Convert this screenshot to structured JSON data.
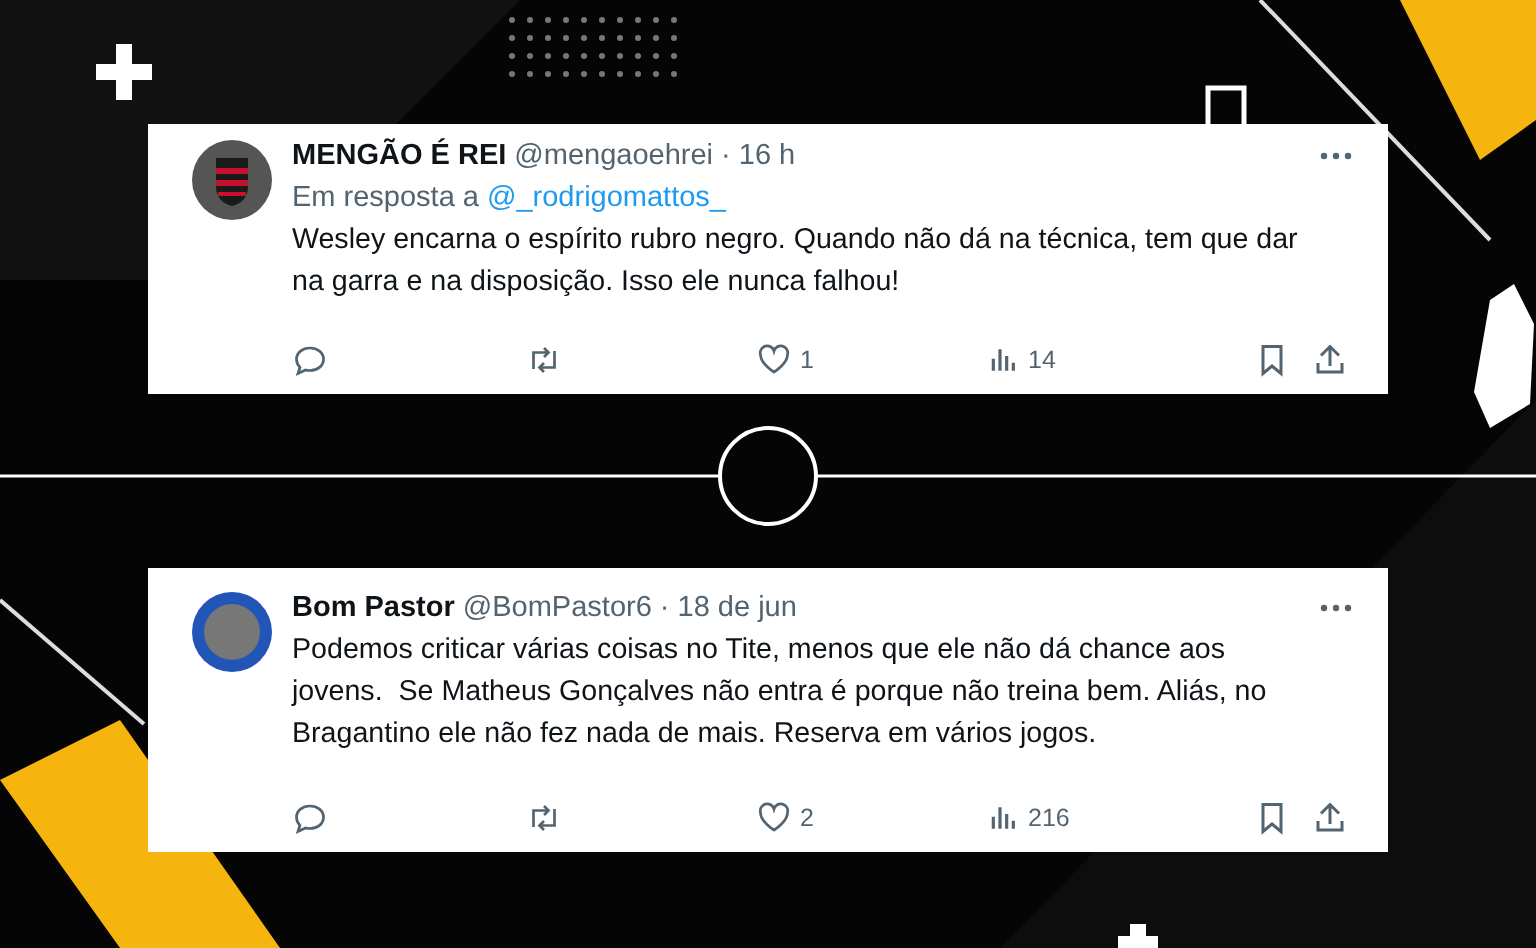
{
  "tweets": [
    {
      "author": "MENGÃO É REI",
      "handle": "@mengaoehrei",
      "time": "· 16 h",
      "kind": "crest",
      "reply_to": {
        "prefix": "Em resposta a",
        "handle": "@_rodrigomattos_"
      },
      "text": "Wesley encarna o espírito rubro negro. Quando não dá na técnica, tem que dar na garra e na disposição. Isso ele nunca falhou!",
      "likes": "1",
      "views": "14"
    },
    {
      "author": "Bom Pastor",
      "handle": "@BomPastor6",
      "time": "· 18 de jun",
      "kind": "photo",
      "text": "Podemos criticar várias coisas no Tite, menos que ele não dá chance aos jovens.  Se Matheus Gonçalves não entra é porque não treina bem. Aliás, no Bragantino ele não fez nada de mais. Reserva em vários jogos.",
      "likes": "2",
      "views": "216"
    }
  ]
}
